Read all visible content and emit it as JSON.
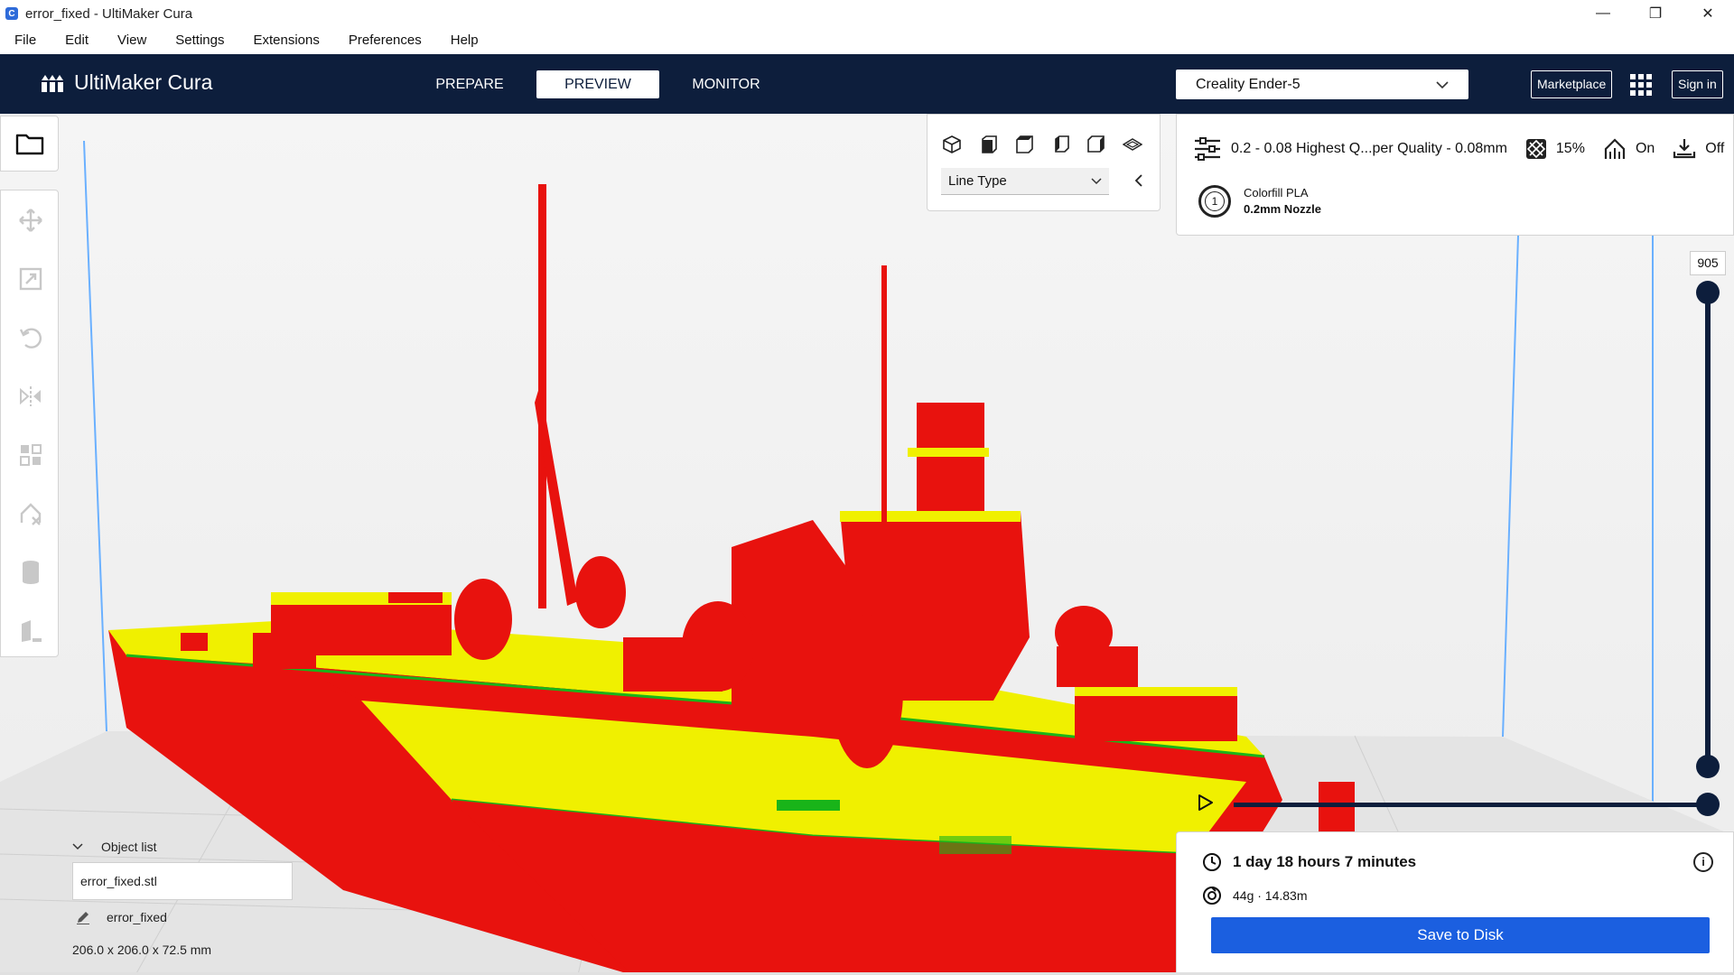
{
  "window": {
    "app_icon_letter": "C",
    "title": "error_fixed - UltiMaker Cura",
    "minimize": "—",
    "restore": "❐",
    "close": "✕"
  },
  "menu": [
    "File",
    "Edit",
    "View",
    "Settings",
    "Extensions",
    "Preferences",
    "Help"
  ],
  "header": {
    "logo_text": "UltiMaker Cura",
    "tabs": [
      {
        "label": "PREPARE",
        "active": false
      },
      {
        "label": "PREVIEW",
        "active": true
      },
      {
        "label": "MONITOR",
        "active": false
      }
    ],
    "printer": "Creality Ender-5",
    "marketplace_label": "Marketplace",
    "signin_label": "Sign in"
  },
  "view_panel": {
    "color_scheme": "Line Type"
  },
  "print_settings": {
    "profile": "0.2 - 0.08 Highest Q...per Quality - 0.08mm",
    "infill": "15%",
    "support": "On",
    "adhesion": "Off",
    "material_slot": "1",
    "material_name": "Colorfill PLA",
    "nozzle": "0.2mm Nozzle"
  },
  "layer_view": {
    "current_layer": "905"
  },
  "object_list": {
    "header": "Object list",
    "file": "error_fixed.stl",
    "object_name": "error_fixed",
    "dimensions": "206.0 x 206.0 x 72.5 mm"
  },
  "print_info": {
    "time": "1 day 18 hours 7 minutes",
    "material_usage": "44g · 14.83m",
    "info_symbol": "i",
    "save_label": "Save to Disk"
  },
  "colors": {
    "header_bg": "#0d1e3c",
    "accent_blue": "#1b5fe0",
    "model_wall": "#e8120e",
    "model_skin": "#f0f000",
    "model_inner_wall": "#19b419"
  }
}
